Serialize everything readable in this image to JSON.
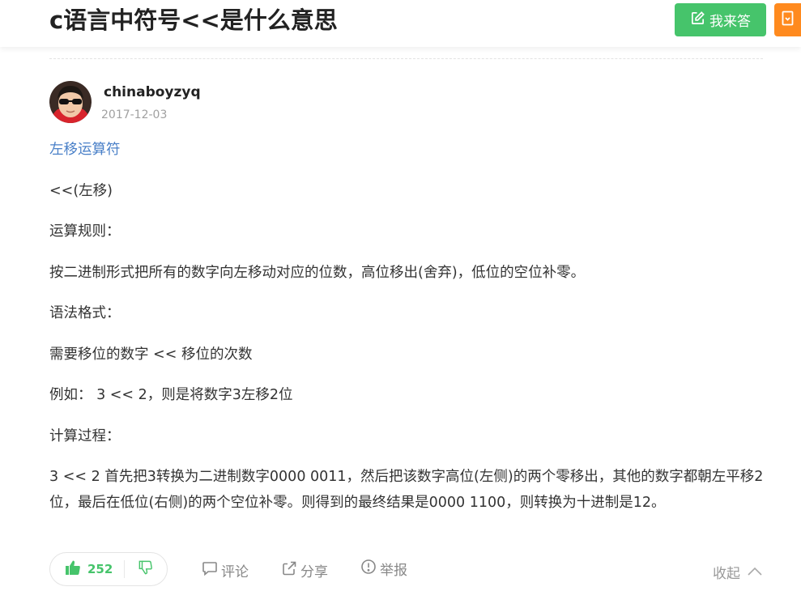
{
  "header": {
    "title": "c语言中符号<<是什么意思",
    "answer_button_label": "我来答"
  },
  "author": {
    "name": "chinaboyzyq",
    "date": "2017-12-03"
  },
  "content": [
    {
      "text": "左移运算符",
      "link": true
    },
    {
      "text": "<<(左移)",
      "link": false
    },
    {
      "text": "运算规则：",
      "link": false
    },
    {
      "text": "按二进制形式把所有的数字向左移动对应的位数，高位移出(舍弃)，低位的空位补零。",
      "link": false
    },
    {
      "text": "语法格式：",
      "link": false
    },
    {
      "text": "需要移位的数字 << 移位的次数",
      "link": false
    },
    {
      "text": "例如： 3 << 2，则是将数字3左移2位",
      "link": false
    },
    {
      "text": "计算过程：",
      "link": false
    },
    {
      "text": "3 << 2 首先把3转换为二进制数字0000 0011，然后把该数字高位(左侧)的两个零移出，其他的数字都朝左平移2位，最后在低位(右侧)的两个空位补零。则得到的最终结果是0000 1100，则转换为十进制是12。",
      "link": false
    }
  ],
  "footer": {
    "upvote_count": "252",
    "comment_label": "评论",
    "share_label": "分享",
    "report_label": "举报",
    "collapse_label": "收起"
  },
  "colors": {
    "accent_green": "#46c46b",
    "accent_orange": "#ff8a1e",
    "link_blue": "#4a80c8"
  },
  "icons": [
    "edit-icon",
    "side-panel-icon",
    "thumbs-up-icon",
    "thumbs-down-icon",
    "comment-icon",
    "share-icon",
    "report-icon",
    "chevron-up-icon"
  ]
}
